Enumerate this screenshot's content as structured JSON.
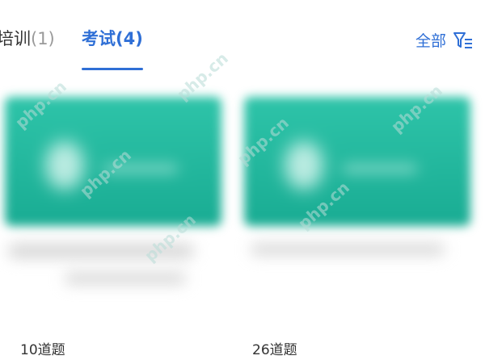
{
  "tabs": {
    "training": {
      "label": "培训",
      "count": "(1)"
    },
    "exam": {
      "label": "考试(4)"
    }
  },
  "filter": {
    "label": "全部",
    "icon": "filter-icon"
  },
  "cards": [
    {
      "question_count": "10道题"
    },
    {
      "question_count": "26道题"
    }
  ],
  "watermark": "php.cn",
  "colors": {
    "accent": "#2f6fd6",
    "cover_teal": "#1fb79c",
    "text": "#333333",
    "muted": "#9a9a9a"
  }
}
